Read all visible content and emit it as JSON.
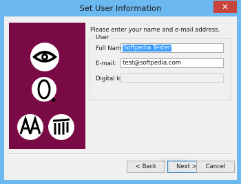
{
  "window": {
    "title": "Set User Information",
    "close_glyph": "✕",
    "accent_color": "#6cb8f0",
    "close_color": "#c7453b"
  },
  "art_panel": {
    "background_color": "#7a0a45",
    "icons": [
      "eye-icon",
      "zero-icon",
      "aa-icon",
      "columns-icon"
    ]
  },
  "form": {
    "prompt": "Please enter your name and e-mail address.",
    "group_label": "User",
    "full_name_label": "Full Name:",
    "full_name_value": "Softpedia Tester",
    "email_label": "E-mail:",
    "email_value": "test@softpedia.com",
    "digital_id_label": "Digital Id:",
    "digital_id_value": ""
  },
  "buttons": {
    "back": "< Back",
    "next": "Next >",
    "cancel": "Cancel"
  },
  "watermark": "SOFTPEDIA"
}
